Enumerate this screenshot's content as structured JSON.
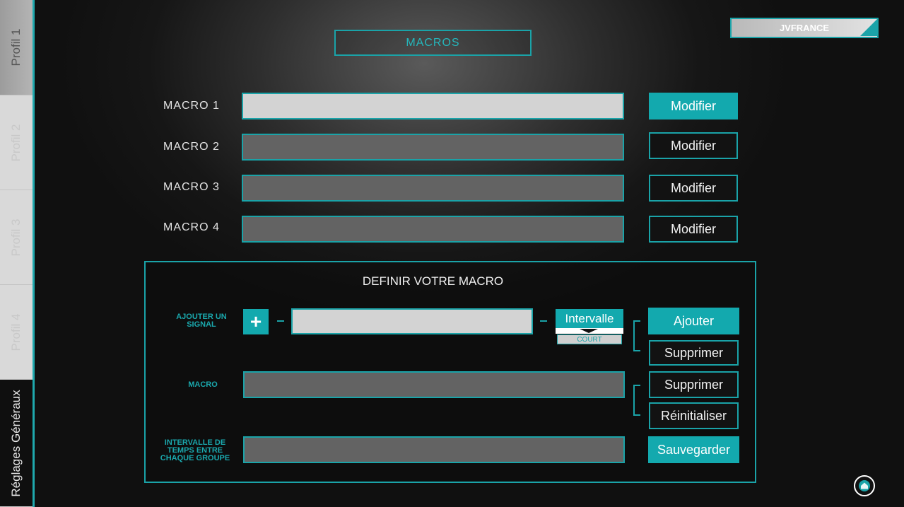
{
  "sidebar": {
    "tabs": [
      {
        "label": "Profil 1",
        "state": "active"
      },
      {
        "label": "Profil 2",
        "state": "inactive"
      },
      {
        "label": "Profil 3",
        "state": "inactive"
      },
      {
        "label": "Profil 4",
        "state": "inactive"
      },
      {
        "label": "Réglages Généraux",
        "state": "dark"
      }
    ]
  },
  "header": {
    "title": "MACROS",
    "brand": "JVFRANCE"
  },
  "macros": [
    {
      "label": "MACRO 1",
      "value": "",
      "button": "Modifier",
      "selected": true
    },
    {
      "label": "MACRO 2",
      "value": "",
      "button": "Modifier",
      "selected": false
    },
    {
      "label": "MACRO 3",
      "value": "",
      "button": "Modifier",
      "selected": false
    },
    {
      "label": "MACRO 4",
      "value": "",
      "button": "Modifier",
      "selected": false
    }
  ],
  "define": {
    "title": "DEFINIR VOTRE MACRO",
    "add_signal_label": "AJOUTER UN SIGNAL",
    "plus_symbol": "+",
    "signal_value": "",
    "interval_label": "Intervalle",
    "interval_option": "COURT",
    "add_button": "Ajouter",
    "delete_button_1": "Supprimer",
    "macro_label": "MACRO",
    "macro_value": "",
    "delete_button_2": "Supprimer",
    "reset_button": "Réinitialiser",
    "group_interval_label": "INTERVALLE DE TEMPS ENTRE CHAQUE GROUPE",
    "group_interval_value": "",
    "save_button": "Sauvegarder"
  },
  "colors": {
    "accent": "#1aa3a8",
    "button_fill": "#13a9ae",
    "field_dark": "#636363",
    "field_light": "#d3d3d3"
  },
  "icons": {
    "home": "home-icon"
  }
}
